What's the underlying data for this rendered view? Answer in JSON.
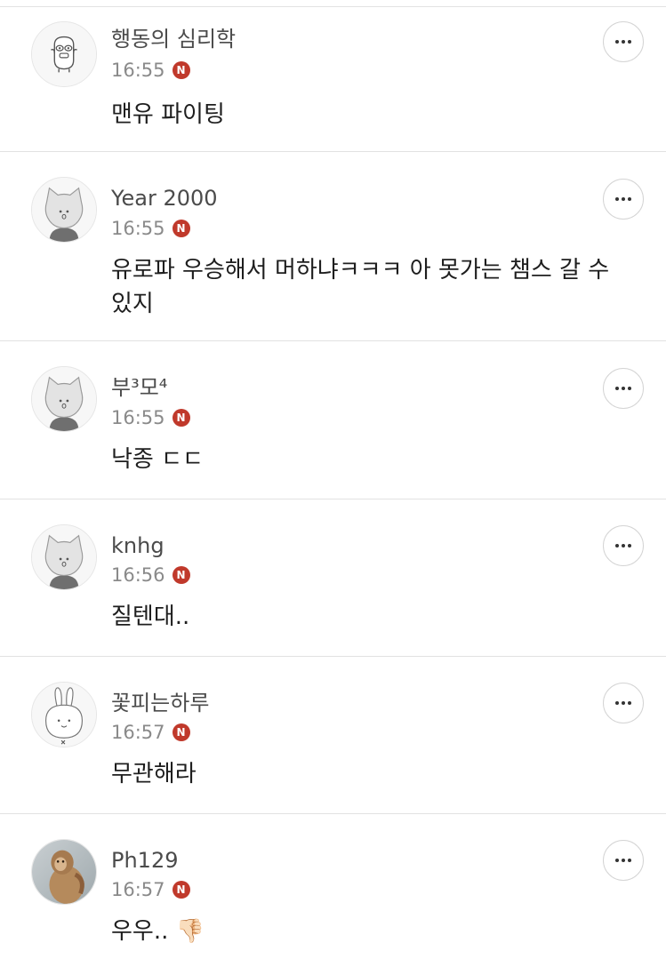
{
  "comments": [
    {
      "nickname": "행동의 심리학",
      "time": "16:55",
      "badge": "N",
      "avatar": "cartoon-character-icon",
      "text": "맨유 파이팅"
    },
    {
      "nickname": "Year 2000",
      "time": "16:55",
      "badge": "N",
      "avatar": "cat-default-icon",
      "text": "유로파 우승해서 머하냐ㅋㅋㅋ 아 못가는 챔스 갈 수 있지"
    },
    {
      "nickname": "부³모⁴",
      "time": "16:55",
      "badge": "N",
      "avatar": "cat-default-icon",
      "text": "낙종 ㄷㄷ"
    },
    {
      "nickname": "knhg",
      "time": "16:56",
      "badge": "N",
      "avatar": "cat-default-icon",
      "text": "질텐대.."
    },
    {
      "nickname": "꽃피는하루",
      "time": "16:57",
      "badge": "N",
      "avatar": "rabbit-default-icon",
      "text": "무관해라"
    },
    {
      "nickname": "Ph129",
      "time": "16:57",
      "badge": "N",
      "avatar": "monkey-photo",
      "text": "우우.. 👎🏻"
    }
  ],
  "colors": {
    "badge": "#c0392b",
    "divider": "#e2e2e2",
    "time": "#8a8a8a",
    "nickname": "#4b4b4b"
  }
}
